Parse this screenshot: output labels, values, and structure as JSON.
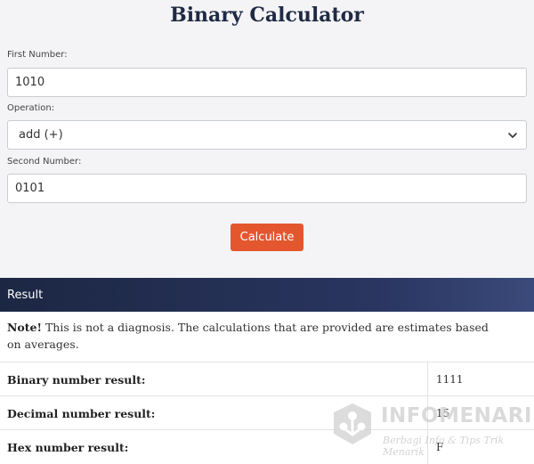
{
  "title": "Binary Calculator",
  "form": {
    "first_label": "First Number:",
    "first_value": "1010",
    "operation_label": "Operation:",
    "operation_selected": "add (+)",
    "second_label": "Second Number:",
    "second_value": "0101",
    "calculate_label": "Calculate"
  },
  "result": {
    "header": "Result",
    "note_bold": "Note!",
    "note_text": " This is not a diagnosis. The calculations that are provided are estimates based on averages.",
    "rows": [
      {
        "label": "Binary number result:",
        "value": "1111"
      },
      {
        "label": "Decimal number result:",
        "value": "15"
      },
      {
        "label": "Hex number result:",
        "value": "F"
      }
    ]
  },
  "watermark": {
    "title": "INFOMENARIK",
    "subtitle": "Berbagi Info & Tips Trik Menarik"
  },
  "colors": {
    "button": "#e4572e",
    "header_dark": "#1c2743",
    "title": "#1f2a44"
  },
  "icons": {
    "select": "chevron-down-icon",
    "watermark": "logo-icon"
  }
}
